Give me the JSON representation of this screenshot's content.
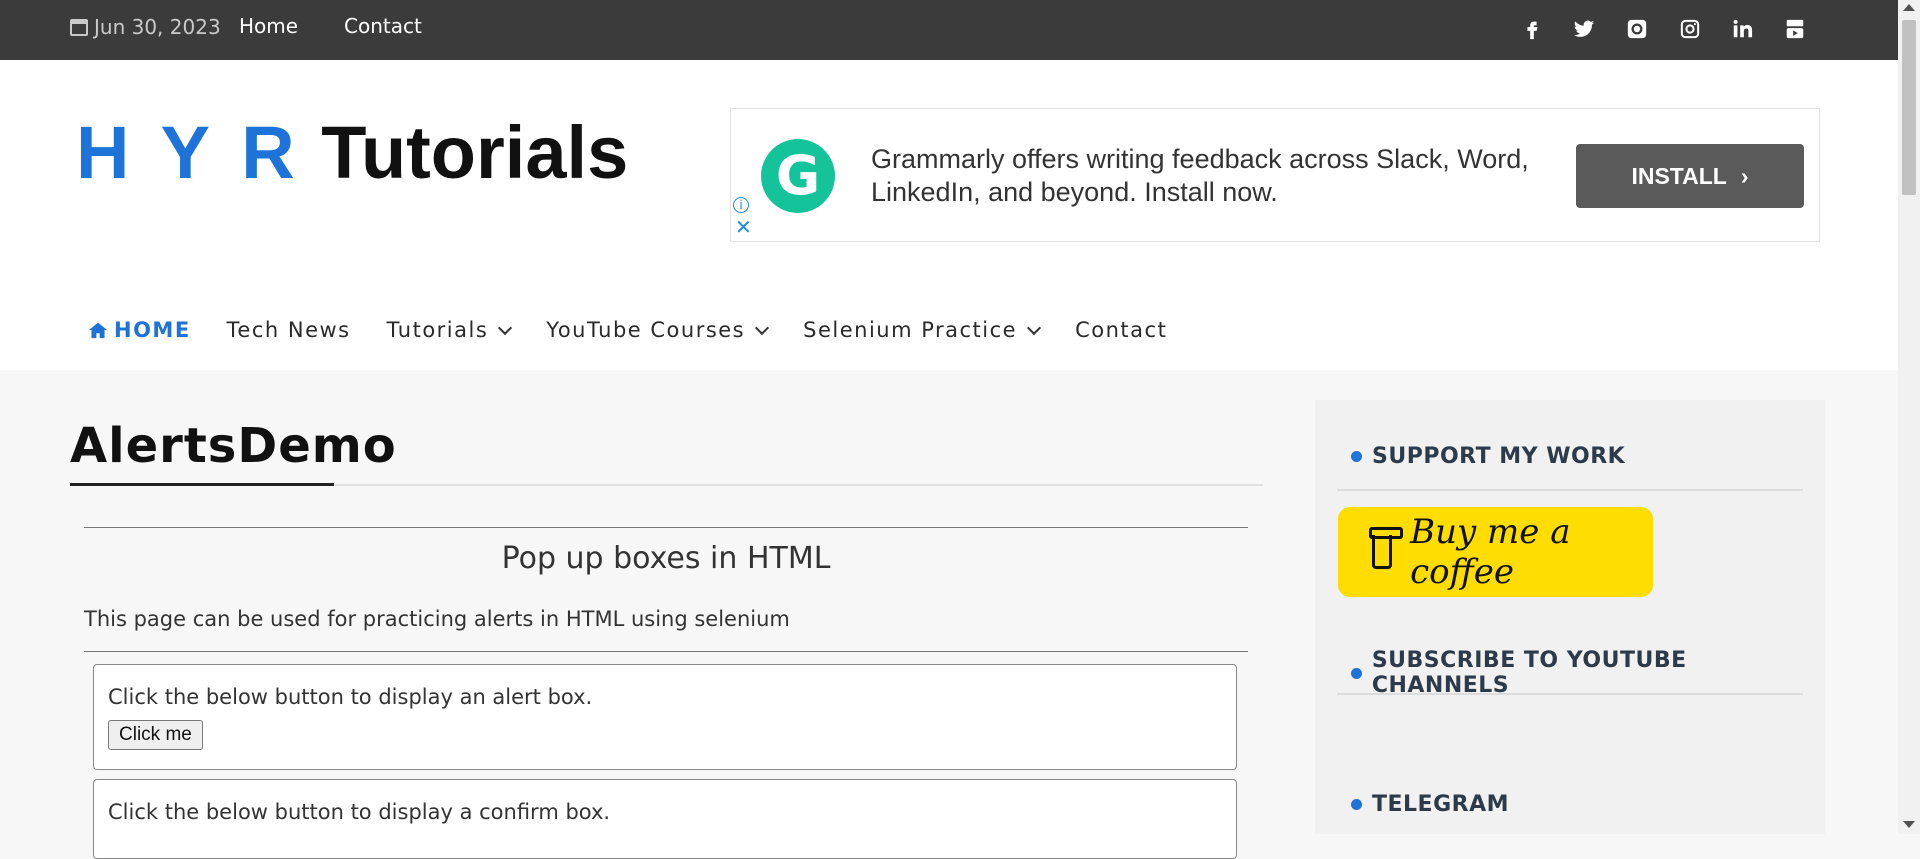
{
  "topbar": {
    "date": "Jun 30, 2023",
    "links": [
      "Home",
      "Contact"
    ],
    "social_icons": [
      "facebook-icon",
      "twitter-icon",
      "github-icon",
      "instagram-icon",
      "linkedin-icon",
      "youtube-icon"
    ]
  },
  "header": {
    "logo_part1": "H Y R",
    "logo_part2": "Tutorials"
  },
  "ad": {
    "brand_letter": "G",
    "text": "Grammarly offers writing feedback across Slack, Word, LinkedIn, and beyond. Install now.",
    "button_label": "INSTALL",
    "info_icon": "info-icon",
    "close_icon": "close-icon",
    "colors": {
      "brand": "#15c39a",
      "button": "#5a5a5a"
    }
  },
  "nav": {
    "items": [
      {
        "label": "HOME",
        "icon": "home-icon"
      },
      {
        "label": "Tech News"
      },
      {
        "label": "Tutorials",
        "dropdown": true
      },
      {
        "label": "YouTube Courses",
        "dropdown": true
      },
      {
        "label": "Selenium Practice",
        "dropdown": true
      },
      {
        "label": "Contact"
      }
    ]
  },
  "main": {
    "page_title": "AlertsDemo",
    "subtitle": "Pop up boxes in HTML",
    "description": "This page can be used for practicing alerts in HTML using selenium",
    "sections": [
      {
        "label": "Click the below button to display an alert box.",
        "button": "Click me"
      },
      {
        "label": "Click the below button to display a confirm box."
      }
    ]
  },
  "sidebar": {
    "widgets": [
      "SUPPORT MY WORK",
      "SUBSCRIBE TO YOUTUBE CHANNELS",
      "TELEGRAM"
    ],
    "coffee_button": "Buy me a coffee",
    "accent": "#1e73d8"
  }
}
